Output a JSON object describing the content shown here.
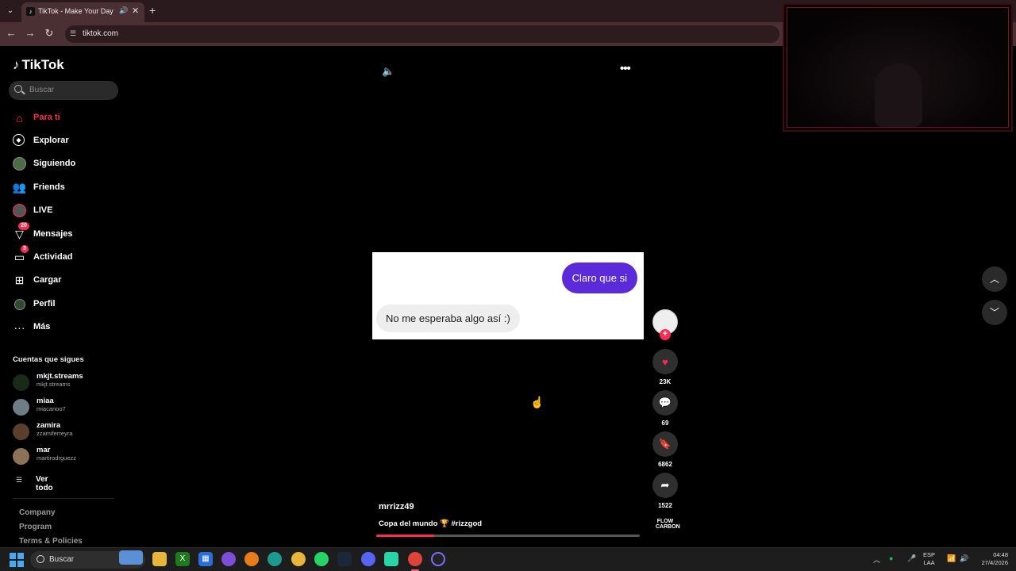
{
  "browser": {
    "tab_title": "TikTok - Make Your Day",
    "url": "tiktok.com"
  },
  "sidebar": {
    "logo_text": "TikTok",
    "search_placeholder": "Buscar",
    "nav_items": [
      {
        "label": "Para ti",
        "icon": "home-icon",
        "active": true
      },
      {
        "label": "Explorar",
        "icon": "compass-icon"
      },
      {
        "label": "Siguiendo",
        "icon": "avatar-icon"
      },
      {
        "label": "Friends",
        "icon": "people-icon"
      },
      {
        "label": "LIVE",
        "icon": "live-icon"
      },
      {
        "label": "Mensajes",
        "icon": "send-icon",
        "badge": "20"
      },
      {
        "label": "Actividad",
        "icon": "inbox-icon",
        "badge": "3"
      },
      {
        "label": "Cargar",
        "icon": "plus-square-icon"
      },
      {
        "label": "Perfil",
        "icon": "profile-icon"
      },
      {
        "label": "Más",
        "icon": "more-icon"
      }
    ],
    "following_title": "Cuentas que sigues",
    "following": [
      {
        "name": "mkjt.streams",
        "handle": "mkjt.streams"
      },
      {
        "name": "miaa",
        "handle": "miacanoo7"
      },
      {
        "name": "zamira",
        "handle": "zzamiferreyra"
      },
      {
        "name": "mar",
        "handle": "martirodrguezz"
      }
    ],
    "see_all": "Ver todo",
    "footer_links": [
      "Company",
      "Program",
      "Terms & Policies"
    ]
  },
  "video": {
    "chat_message_sent": "Claro que si",
    "chat_message_received": "No me esperaba algo así :)",
    "author": "mrrizz49",
    "description": "Copa del mundo 🏆 #rizzgod",
    "progress": 0.22,
    "likes": "23K",
    "comments": "69",
    "saves": "6862",
    "shares": "1522",
    "brand_watermark": "FLOW CARBON"
  },
  "taskbar": {
    "search_label": "Buscar",
    "language_line1": "ESP",
    "language_line2": "LAA",
    "time": "04:48",
    "date": "27/4/2026"
  },
  "colors": {
    "accent": "#fe2c55",
    "chat_bubble": "#5b2bd9",
    "browser_frame": "#4a2f33"
  }
}
